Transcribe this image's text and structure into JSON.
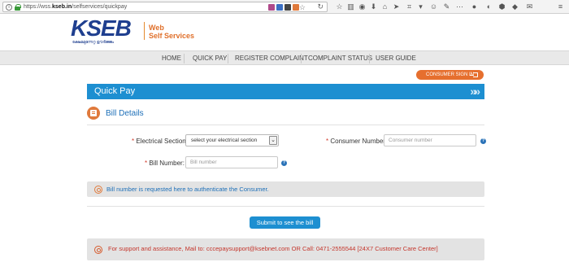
{
  "browser": {
    "url_prefix": "https://wss.",
    "url_domain": "kseb.in",
    "url_path": "/selfservices/quickpay"
  },
  "header": {
    "logo_text": "KSEB",
    "logo_tagline": "ക്ഷേമമുന്നേറ്റ ഊർജ്ജം",
    "title_line1": "Web",
    "title_line2": "Self Services"
  },
  "nav": {
    "items": [
      "HOME",
      "QUICK PAY",
      "REGISTER COMPLAINT",
      "COMPLAINT STATUS",
      "USER GUIDE"
    ]
  },
  "consumer_signin": "CONSUMER SIGN IN",
  "quick_pay": {
    "title": "Quick Pay",
    "arrows": "»»"
  },
  "bill_details": {
    "title": "Bill Details"
  },
  "form": {
    "electrical_section_label": "Electrical Section:",
    "electrical_section_value": "select your electrical section",
    "consumer_number_label": "Consumer Number:",
    "consumer_number_placeholder": "Consumer number",
    "bill_number_label": "Bill Number:",
    "bill_number_placeholder": "Bill number",
    "required_mark": "*",
    "help_mark": "?"
  },
  "info_message": "Bill number is requested here to authenticate the Consumer.",
  "submit_label": "Submit to see the bill",
  "support_message": "For support and assistance, Mail to: cccepaysupport@ksebnet.com OR Call: 0471-2555544 [24X7 Customer Care Center]",
  "colors": {
    "accent_blue": "#1d8fd1",
    "accent_orange": "#e66f2e",
    "logo_blue": "#1f3f8f",
    "error_red": "#c4352b"
  }
}
